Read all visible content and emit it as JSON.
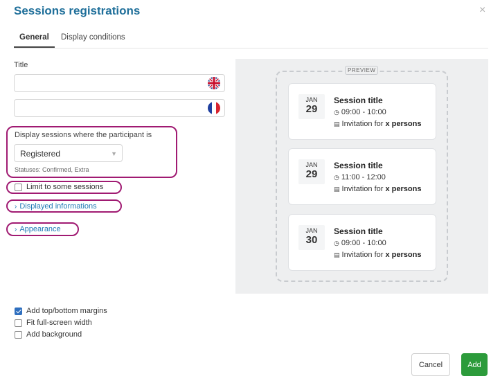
{
  "modal": {
    "title": "Sessions registrations",
    "close_label": "×"
  },
  "tabs": [
    {
      "label": "General"
    },
    {
      "label": "Display conditions"
    }
  ],
  "form": {
    "title_label": "Title",
    "title_en_value": "",
    "title_fr_value": "",
    "display_label": "Display sessions where the participant is",
    "status_selected": "Registered",
    "statuses_hint": "Statuses: Confirmed, Extra",
    "limit_label": "Limit to some sessions",
    "displayed_info_link": "Displayed informations",
    "appearance_link": "Appearance"
  },
  "preview": {
    "tag": "PREVIEW",
    "sessions": [
      {
        "month": "JAN",
        "day": "29",
        "title": "Session title",
        "time": "09:00 - 10:00",
        "invitation_prefix": "Invitation for",
        "invitation_bold": "x persons"
      },
      {
        "month": "JAN",
        "day": "29",
        "title": "Session title",
        "time": "11:00 - 12:00",
        "invitation_prefix": "Invitation for",
        "invitation_bold": "x persons"
      },
      {
        "month": "JAN",
        "day": "30",
        "title": "Session title",
        "time": "09:00 - 10:00",
        "invitation_prefix": "Invitation for",
        "invitation_bold": "x persons"
      }
    ]
  },
  "options": [
    {
      "label": "Add top/bottom margins",
      "checked": true
    },
    {
      "label": "Fit full-screen width",
      "checked": false
    },
    {
      "label": "Add background",
      "checked": false
    }
  ],
  "footer": {
    "cancel_label": "Cancel",
    "add_label": "Add"
  },
  "colors": {
    "title": "#1f6f9a",
    "link": "#1f79b5",
    "highlight": "#a01a72",
    "add_button": "#2c9b3b",
    "checkbox": "#2f6fbf"
  },
  "icons": {
    "close": "close-icon",
    "uk_flag": "uk-flag-icon",
    "fr_flag": "fr-flag-icon",
    "clock": "clock-icon",
    "ticket": "ticket-icon",
    "chevron": "chevron-right-icon",
    "caret": "caret-down-icon"
  }
}
